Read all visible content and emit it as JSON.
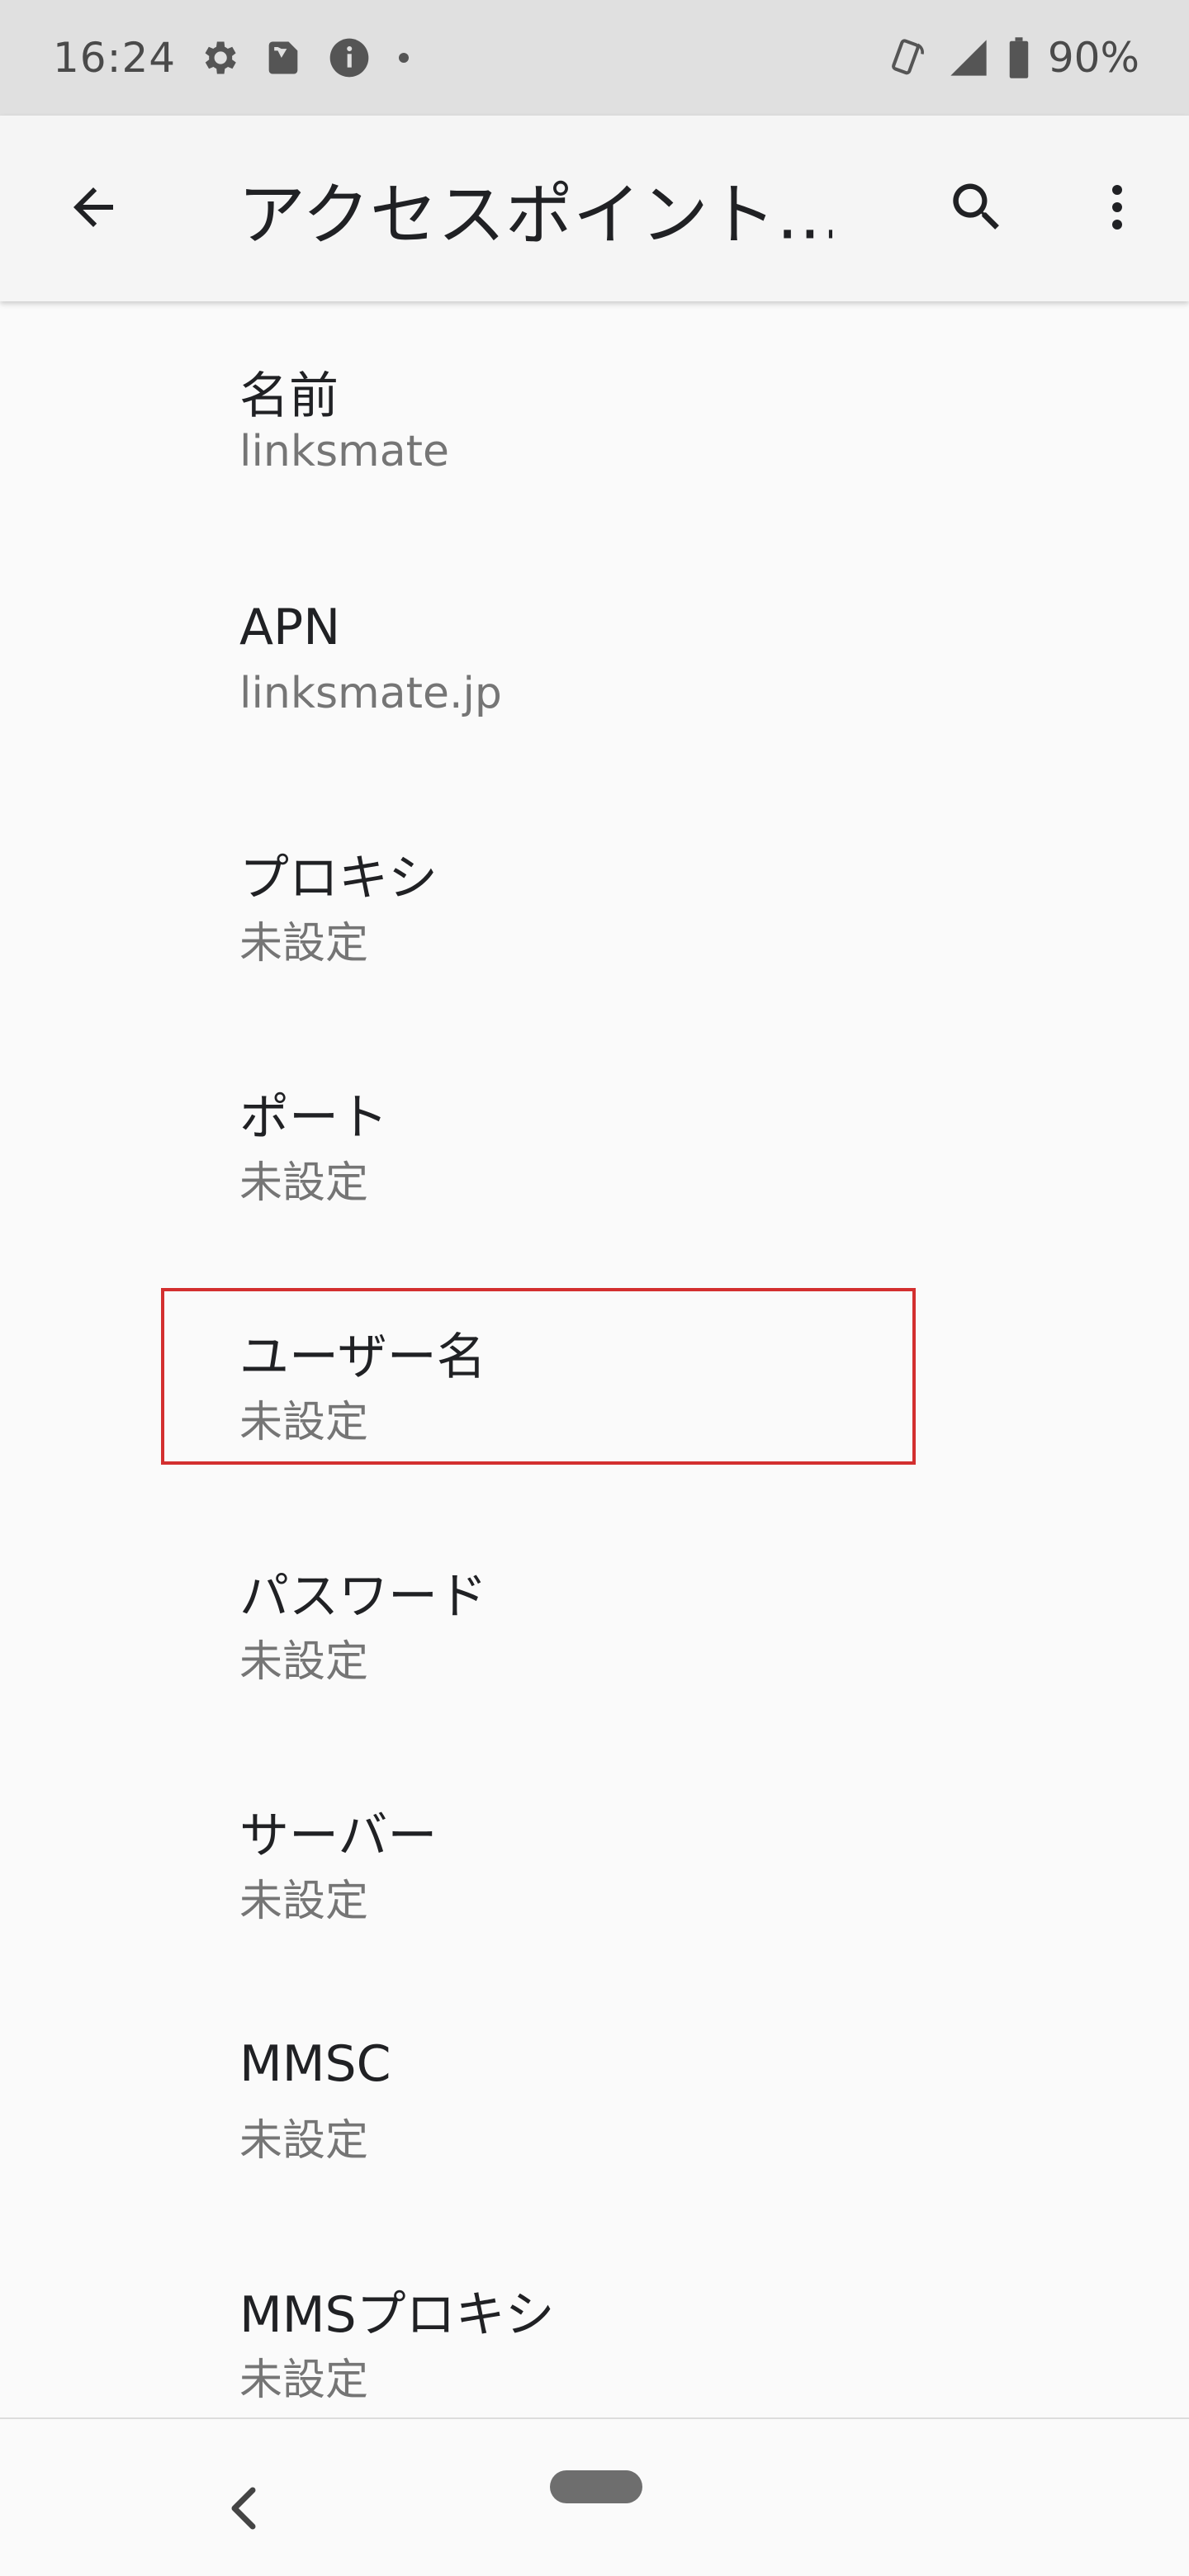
{
  "status_bar": {
    "time": "16:24",
    "left_icons": [
      "gear-icon",
      "sim-card-icon",
      "info-icon",
      "dot-icon"
    ],
    "right_icons": [
      "vibrate-icon",
      "signal-icon",
      "battery-icon"
    ],
    "battery_percent": "90%"
  },
  "app_bar": {
    "title": "アクセスポイント…",
    "back_icon": "arrow-back-icon",
    "search_icon": "search-icon",
    "more_icon": "more-vert-icon"
  },
  "preferences": [
    {
      "title": "名前",
      "summary": "linksmate"
    },
    {
      "title": "APN",
      "summary": "linksmate.jp"
    },
    {
      "title": "プロキシ",
      "summary": "未設定"
    },
    {
      "title": "ポート",
      "summary": "未設定"
    },
    {
      "title": "ユーザー名",
      "summary": "未設定"
    },
    {
      "title": "パスワード",
      "summary": "未設定"
    },
    {
      "title": "サーバー",
      "summary": "未設定"
    },
    {
      "title": "MMSC",
      "summary": "未設定"
    },
    {
      "title": "MMSプロキシ",
      "summary": "未設定"
    }
  ],
  "highlight": {
    "target": "ユーザー名",
    "color": "#d32f2f"
  },
  "nav_bar": {
    "back_icon": "nav-back-icon",
    "home_icon": "home-pill-icon"
  }
}
